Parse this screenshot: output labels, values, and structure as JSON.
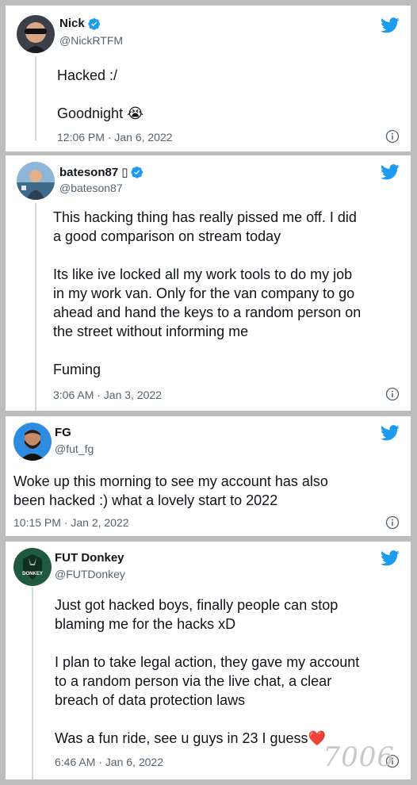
{
  "tweets": [
    {
      "name": "Nick",
      "badge": "",
      "handle": "@NickRTFM",
      "text": "Hacked :/\n\nGoodnight",
      "emoji": "😭",
      "timestamp": "12:06 PM · Jan 6, 2022"
    },
    {
      "name": "bateson87",
      "badge": "▯",
      "handle": "@bateson87",
      "text": "This hacking thing has really pissed me off. I did\na good comparison on stream today\n\nIts like ive locked all my work tools to do my job\nin my work van. Only for the van company to go\nahead and hand the keys to a random person on\nthe street without informing me\n\nFuming",
      "emoji": "",
      "timestamp": "3:06 AM · Jan 3, 2022"
    },
    {
      "name": "FG",
      "badge": "",
      "handle": "@fut_fg",
      "text": "Woke up this morning to see my account has also\nbeen hacked :) what a lovely start to 2022",
      "emoji": "",
      "timestamp": "10:15 PM · Jan 2, 2022"
    },
    {
      "name": "FUT Donkey",
      "badge": "",
      "handle": "@FUTDonkey",
      "avatar_label": "DONKEY",
      "text": "Just got hacked boys, finally people can stop\nblaming me for the hacks xD\n\nI plan to take legal action, they gave my account\nto a random person via the live chat, a clear\nbreach of data protection laws\n\nWas a fun ride, see u guys in 23 I guess",
      "emoji": "❤️",
      "timestamp": "6:46 AM · Jan 6, 2022"
    }
  ],
  "watermark": "7006",
  "colors": {
    "twitter_blue": "#1d9bf0",
    "muted": "#536471",
    "line": "#cfd9de"
  },
  "icons": [
    "verified-badge-icon",
    "twitter-bird-icon",
    "info-icon"
  ]
}
